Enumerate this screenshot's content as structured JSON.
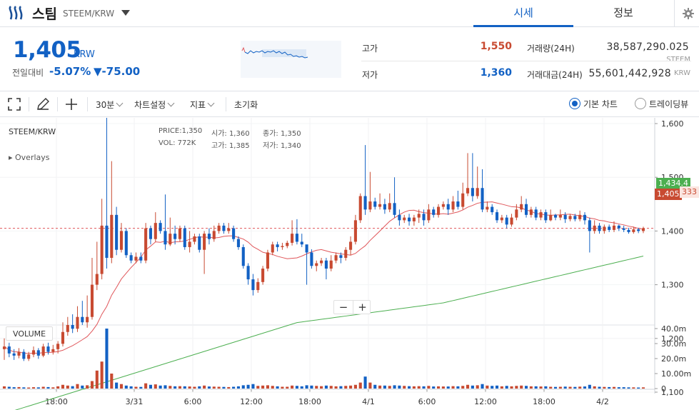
{
  "header": {
    "coin_name": "스팀",
    "pair": "STEEM/KRW",
    "tabs": [
      {
        "label": "시세"
      },
      {
        "label": "정보"
      }
    ]
  },
  "summary": {
    "price": "1,405",
    "price_unit": "KRW",
    "change_label": "전일대비",
    "change_rate": "-5.07%",
    "change_amount": "▼-75.00",
    "high_label": "고가",
    "high_value": "1,550",
    "low_label": "저가",
    "low_value": "1,360",
    "volume_label": "거래량(24H)",
    "volume_value": "38,587,290.025",
    "volume_unit": "STEEM",
    "amount_label": "거래대금(24H)",
    "amount_value": "55,601,442,928",
    "amount_unit": "KRW"
  },
  "toolbar": {
    "interval": "30분",
    "chart_settings": "차트설정",
    "indicators": "지표",
    "reset": "초기화",
    "basic_chart": "기본 차트",
    "tradingview": "트레이딩뷰"
  },
  "chart_info": {
    "symbol": "STEEM/KRW",
    "price_text": "PRICE:1,350",
    "open_text": "시가: 1,360",
    "close_text": "종가: 1,350",
    "vol_text": "VOL:   772K",
    "high_text": "고가: 1,385",
    "low_text": "저가: 1,340",
    "overlays": "▸ Overlays",
    "volume_title": "VOLUME",
    "badge_ma": "1,434.4",
    "badge_price": "1,405",
    "badge_countdown": "333"
  },
  "colors": {
    "up": "#c84a31",
    "down": "#1261c4",
    "ma_short": "#e0565a",
    "ma_long": "#4caf50",
    "accent": "#1261c4"
  },
  "chart_data": {
    "type": "candlestick",
    "y_axis": {
      "min": 1000,
      "max": 1620,
      "ticks": [
        "1,600",
        "1,500",
        "1,400",
        "1,300",
        "1,200",
        "1,100"
      ]
    },
    "volume_axis": {
      "ticks": [
        "40.0m",
        "30.0m",
        "20.0m",
        "10.00m",
        "0"
      ]
    },
    "x_ticks": [
      "18:00",
      "3/31",
      "6:00",
      "12:00",
      "18:00",
      "4/1",
      "6:00",
      "12:00",
      "18:00",
      "4/2"
    ],
    "candles": [
      [
        1180,
        1185,
        1160,
        1200,
        1.5
      ],
      [
        1185,
        1172,
        1165,
        1192,
        1.2
      ],
      [
        1172,
        1168,
        1160,
        1180,
        0.9
      ],
      [
        1168,
        1175,
        1163,
        1182,
        1.0
      ],
      [
        1175,
        1162,
        1158,
        1180,
        0.8
      ],
      [
        1162,
        1170,
        1158,
        1175,
        0.7
      ],
      [
        1170,
        1178,
        1165,
        1185,
        0.9
      ],
      [
        1178,
        1168,
        1162,
        1182,
        0.8
      ],
      [
        1168,
        1185,
        1165,
        1190,
        1.2
      ],
      [
        1185,
        1175,
        1170,
        1192,
        1.0
      ],
      [
        1175,
        1180,
        1170,
        1188,
        0.8
      ],
      [
        1180,
        1190,
        1172,
        1195,
        1.5
      ],
      [
        1190,
        1212,
        1185,
        1230,
        2.5
      ],
      [
        1212,
        1225,
        1205,
        1240,
        2.0
      ],
      [
        1225,
        1218,
        1210,
        1245,
        1.6
      ],
      [
        1218,
        1240,
        1212,
        1260,
        3.0
      ],
      [
        1240,
        1230,
        1225,
        1270,
        2.0
      ],
      [
        1230,
        1240,
        1220,
        1280,
        2.2
      ],
      [
        1240,
        1300,
        1235,
        1350,
        5.0
      ],
      [
        1300,
        1320,
        1290,
        1380,
        12.0
      ],
      [
        1320,
        1410,
        1310,
        1460,
        18.0
      ],
      [
        1410,
        1350,
        1330,
        1625,
        40.0
      ],
      [
        1350,
        1430,
        1340,
        1530,
        10.0
      ],
      [
        1430,
        1365,
        1355,
        1445,
        4.0
      ],
      [
        1365,
        1400,
        1360,
        1415,
        3.0
      ],
      [
        1400,
        1355,
        1350,
        1405,
        2.0
      ],
      [
        1355,
        1345,
        1340,
        1360,
        1.5
      ],
      [
        1345,
        1352,
        1340,
        1360,
        1.2
      ],
      [
        1352,
        1345,
        1340,
        1360,
        1.1
      ],
      [
        1345,
        1405,
        1340,
        1415,
        3.5
      ],
      [
        1405,
        1385,
        1375,
        1410,
        2.5
      ],
      [
        1385,
        1415,
        1380,
        1435,
        2.8
      ],
      [
        1415,
        1400,
        1395,
        1420,
        2.0
      ],
      [
        1400,
        1375,
        1365,
        1468,
        2.2
      ],
      [
        1375,
        1395,
        1372,
        1425,
        1.8
      ],
      [
        1395,
        1385,
        1375,
        1410,
        1.5
      ],
      [
        1385,
        1405,
        1380,
        1410,
        1.6
      ],
      [
        1405,
        1370,
        1365,
        1410,
        1.5
      ],
      [
        1370,
        1380,
        1360,
        1400,
        1.4
      ],
      [
        1380,
        1390,
        1375,
        1395,
        1.2
      ],
      [
        1390,
        1365,
        1360,
        1395,
        1.5
      ],
      [
        1365,
        1395,
        1320,
        1400,
        2.0
      ],
      [
        1395,
        1385,
        1375,
        1405,
        1.4
      ],
      [
        1385,
        1400,
        1380,
        1410,
        1.3
      ],
      [
        1400,
        1410,
        1395,
        1415,
        1.2
      ],
      [
        1410,
        1400,
        1395,
        1415,
        1.1
      ],
      [
        1400,
        1405,
        1395,
        1415,
        1.0
      ],
      [
        1405,
        1385,
        1380,
        1410,
        1.2
      ],
      [
        1385,
        1370,
        1365,
        1390,
        1.5
      ],
      [
        1370,
        1335,
        1330,
        1375,
        2.2
      ],
      [
        1335,
        1310,
        1300,
        1340,
        2.5
      ],
      [
        1310,
        1290,
        1280,
        1320,
        3.0
      ],
      [
        1290,
        1305,
        1285,
        1312,
        1.8
      ],
      [
        1305,
        1330,
        1300,
        1335,
        2.0
      ],
      [
        1330,
        1360,
        1325,
        1365,
        2.2
      ],
      [
        1360,
        1375,
        1355,
        1380,
        1.8
      ],
      [
        1375,
        1370,
        1362,
        1380,
        1.5
      ],
      [
        1370,
        1372,
        1365,
        1378,
        1.2
      ],
      [
        1372,
        1378,
        1368,
        1382,
        1.2
      ],
      [
        1378,
        1395,
        1373,
        1420,
        2.0
      ],
      [
        1395,
        1380,
        1375,
        1422,
        1.8
      ],
      [
        1380,
        1375,
        1370,
        1395,
        1.5
      ],
      [
        1375,
        1360,
        1300,
        1370,
        2.2
      ],
      [
        1360,
        1335,
        1330,
        1366,
        2.0
      ],
      [
        1335,
        1340,
        1325,
        1345,
        1.8
      ],
      [
        1340,
        1345,
        1335,
        1350,
        1.6
      ],
      [
        1345,
        1330,
        1310,
        1350,
        2.0
      ],
      [
        1330,
        1345,
        1325,
        1355,
        1.8
      ],
      [
        1345,
        1355,
        1340,
        1360,
        1.5
      ],
      [
        1355,
        1350,
        1340,
        1360,
        1.6
      ],
      [
        1350,
        1365,
        1345,
        1370,
        1.8
      ],
      [
        1365,
        1380,
        1355,
        1390,
        2.0
      ],
      [
        1380,
        1420,
        1375,
        1430,
        2.5
      ],
      [
        1420,
        1465,
        1415,
        1470,
        4.0
      ],
      [
        1465,
        1440,
        1430,
        1560,
        8.0
      ],
      [
        1440,
        1455,
        1435,
        1510,
        4.0
      ],
      [
        1455,
        1445,
        1440,
        1462,
        2.5
      ],
      [
        1445,
        1450,
        1440,
        1470,
        2.0
      ],
      [
        1450,
        1440,
        1432,
        1460,
        2.0
      ],
      [
        1440,
        1452,
        1435,
        1470,
        1.8
      ],
      [
        1452,
        1430,
        1425,
        1500,
        2.2
      ],
      [
        1430,
        1420,
        1410,
        1440,
        2.0
      ],
      [
        1420,
        1425,
        1415,
        1430,
        1.8
      ],
      [
        1425,
        1418,
        1410,
        1432,
        1.6
      ],
      [
        1418,
        1425,
        1410,
        1430,
        1.5
      ],
      [
        1425,
        1432,
        1415,
        1440,
        1.6
      ],
      [
        1432,
        1420,
        1410,
        1440,
        1.5
      ],
      [
        1420,
        1440,
        1415,
        1450,
        1.8
      ],
      [
        1440,
        1430,
        1425,
        1445,
        1.4
      ],
      [
        1430,
        1445,
        1425,
        1450,
        1.5
      ],
      [
        1445,
        1450,
        1440,
        1455,
        1.4
      ],
      [
        1450,
        1440,
        1430,
        1460,
        1.4
      ],
      [
        1440,
        1455,
        1435,
        1465,
        1.6
      ],
      [
        1455,
        1445,
        1440,
        1475,
        1.5
      ],
      [
        1445,
        1470,
        1440,
        1490,
        1.8
      ],
      [
        1470,
        1480,
        1465,
        1545,
        2.5
      ],
      [
        1480,
        1465,
        1455,
        1545,
        2.0
      ],
      [
        1465,
        1480,
        1460,
        1520,
        2.2
      ],
      [
        1480,
        1440,
        1435,
        1515,
        3.0
      ],
      [
        1440,
        1445,
        1435,
        1455,
        2.0
      ],
      [
        1445,
        1435,
        1430,
        1450,
        1.8
      ],
      [
        1435,
        1420,
        1415,
        1440,
        2.0
      ],
      [
        1420,
        1425,
        1415,
        1430,
        1.5
      ],
      [
        1425,
        1412,
        1405,
        1430,
        1.8
      ],
      [
        1412,
        1425,
        1408,
        1432,
        1.5
      ],
      [
        1425,
        1440,
        1420,
        1450,
        1.8
      ],
      [
        1440,
        1450,
        1435,
        1465,
        2.0
      ],
      [
        1450,
        1430,
        1425,
        1460,
        1.8
      ],
      [
        1430,
        1440,
        1425,
        1445,
        1.5
      ],
      [
        1440,
        1425,
        1420,
        1445,
        1.5
      ],
      [
        1425,
        1435,
        1420,
        1440,
        1.4
      ],
      [
        1435,
        1420,
        1415,
        1440,
        1.5
      ],
      [
        1420,
        1430,
        1418,
        1440,
        1.2
      ],
      [
        1430,
        1425,
        1420,
        1432,
        1.1
      ],
      [
        1425,
        1430,
        1420,
        1440,
        1.2
      ],
      [
        1430,
        1422,
        1415,
        1435,
        1.3
      ],
      [
        1422,
        1428,
        1418,
        1432,
        1.2
      ],
      [
        1428,
        1422,
        1418,
        1432,
        1.1
      ],
      [
        1422,
        1430,
        1418,
        1438,
        1.3
      ],
      [
        1430,
        1420,
        1412,
        1435,
        1.4
      ],
      [
        1420,
        1400,
        1360,
        1425,
        2.5
      ],
      [
        1400,
        1410,
        1395,
        1420,
        1.5
      ],
      [
        1410,
        1400,
        1395,
        1415,
        1.2
      ],
      [
        1400,
        1408,
        1395,
        1412,
        1.1
      ],
      [
        1408,
        1402,
        1398,
        1412,
        1.0
      ],
      [
        1402,
        1410,
        1398,
        1418,
        1.1
      ],
      [
        1410,
        1405,
        1400,
        1412,
        0.9
      ],
      [
        1405,
        1402,
        1398,
        1410,
        0.9
      ],
      [
        1402,
        1398,
        1395,
        1406,
        0.8
      ],
      [
        1398,
        1403,
        1395,
        1408,
        0.8
      ],
      [
        1403,
        1400,
        1396,
        1406,
        0.7
      ],
      [
        1400,
        1405,
        1396,
        1408,
        0.8
      ]
    ]
  }
}
